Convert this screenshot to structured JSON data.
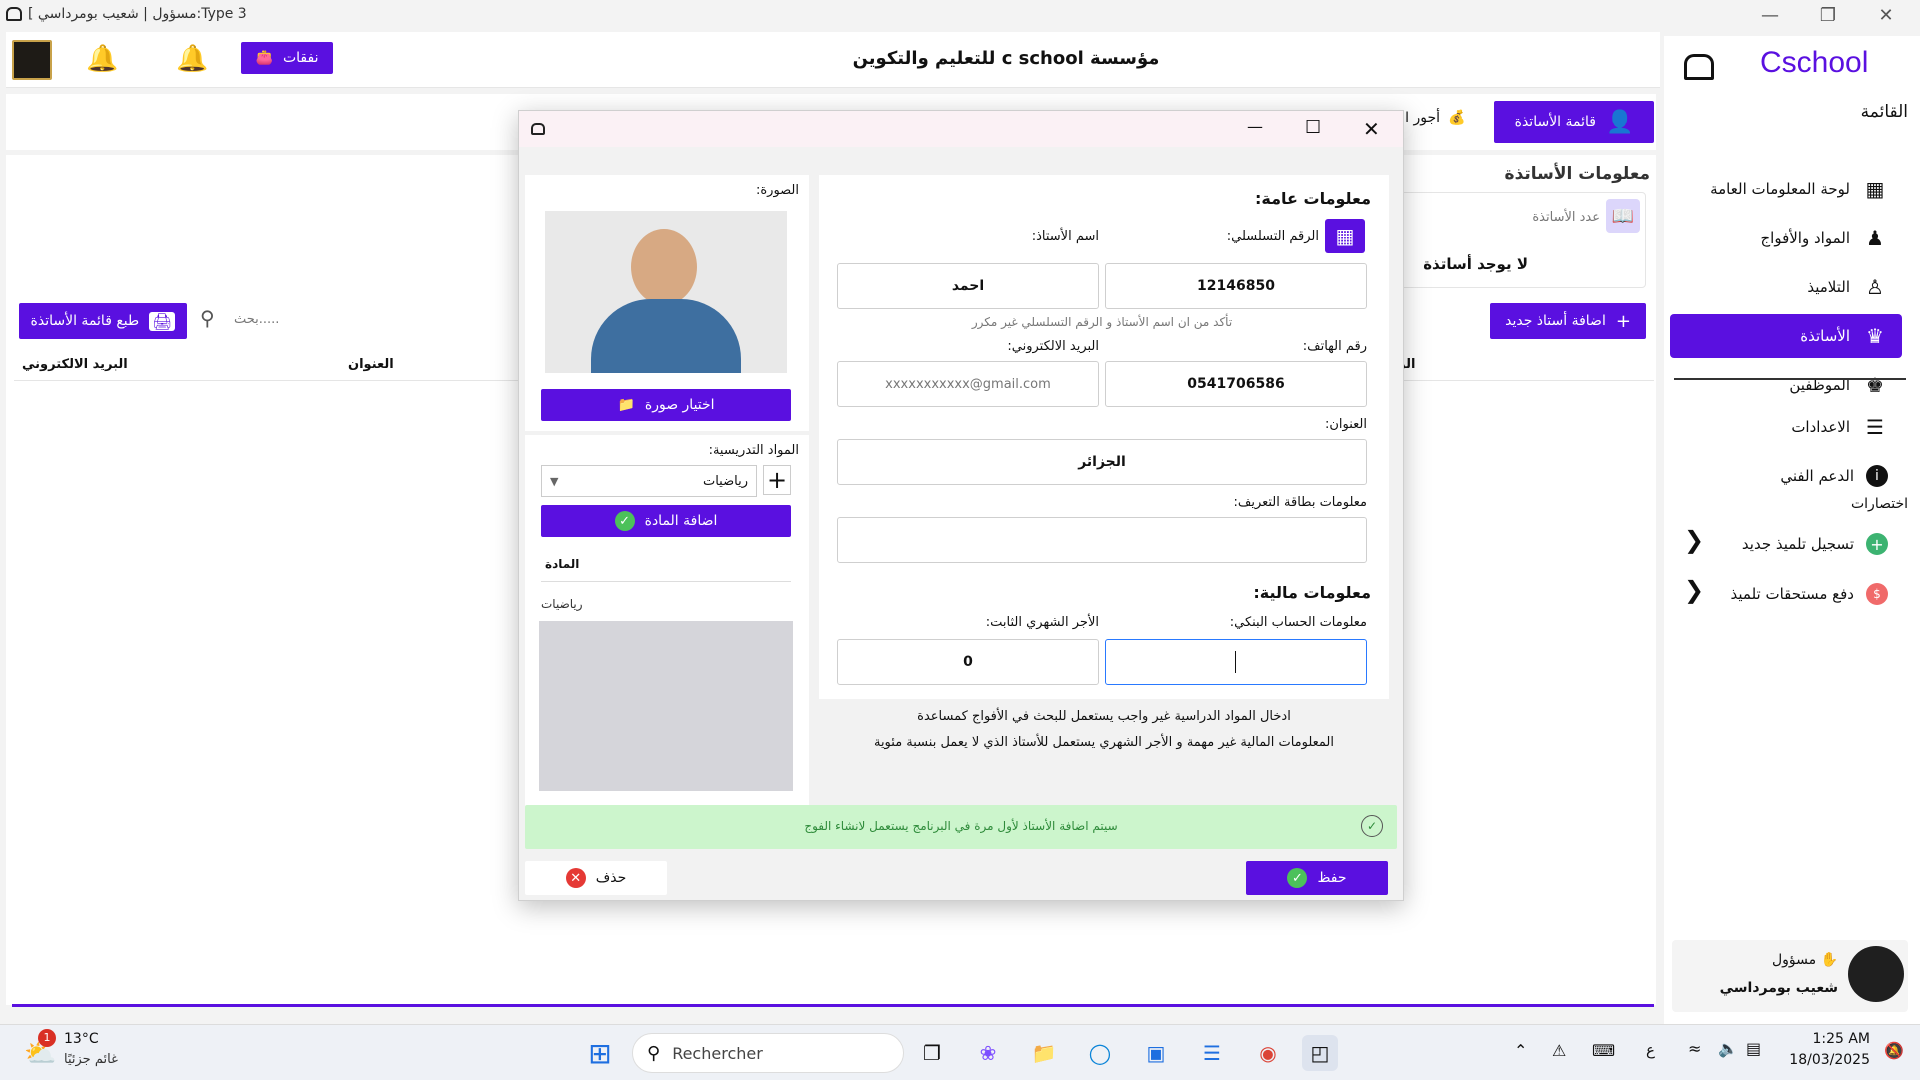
{
  "window": {
    "title": "[ مسؤول | شعيب بومرداسي:Type 3"
  },
  "header": {
    "title": "مؤسسة c school للتعليم والتكوين",
    "expenses_button": "نفقات"
  },
  "sidebar": {
    "brand": "Cschool",
    "menu_title": "القائمة",
    "items": [
      {
        "label": "لوحة المعلومات العامة",
        "icon": "dashboard-icon"
      },
      {
        "label": "المواد والأفواج",
        "icon": "groups-icon"
      },
      {
        "label": "التلاميذ",
        "icon": "students-icon"
      },
      {
        "label": "الأساتذة",
        "icon": "teacher-icon",
        "active": true
      },
      {
        "label": "الموظفين",
        "icon": "employees-icon"
      }
    ],
    "settings_items": [
      {
        "label": "الاعدادات",
        "icon": "sliders-icon"
      },
      {
        "label": "الدعم الفني",
        "icon": "info-icon"
      }
    ],
    "shortcuts_title": "اختصارات",
    "shortcuts": [
      {
        "label": "تسجيل تلميذ جديد",
        "icon": "plus-circle-icon"
      },
      {
        "label": "دفع مستحقات تلميذ",
        "icon": "cash-icon"
      }
    ],
    "user": {
      "role": "مسؤول",
      "name": "شعيب بومرداسي"
    }
  },
  "main": {
    "tab_teachers_list": "قائمة الأساتذة",
    "tab_salaries": "أجور ال",
    "section_title": "معلومات الأساتذة",
    "count_label": "عدد الأساتذة",
    "count_value": "لا يوجد أساتذة",
    "add_teacher_button": "اضافة أستاذ جديد",
    "print_button": "طبع قائمة الأساتذة",
    "search_placeholder": "بحث.....",
    "columns": {
      "email": "البريد الالكتروني",
      "address": "العنوان",
      "partial": "الر"
    }
  },
  "dialog": {
    "general_title": "معلومات عامة:",
    "serial_label": "الرقم التسلسلي:",
    "name_label": "اسم الأستاذ:",
    "serial_value": "12146850",
    "name_value": "احمد",
    "hint": "تأكد من ان اسم الأستاذ و الرقم التسلسلي غير مكرر",
    "phone_label": "رقم الهاتف:",
    "email_label": "البريد الالكتروني:",
    "phone_value": "0541706586",
    "email_placeholder": "xxxxxxxxxxx@gmail.com",
    "address_label": "العنوان:",
    "address_value": "الجزائر",
    "id_card_label": "معلومات بطاقة التعريف:",
    "id_card_value": "",
    "financial_title": "معلومات مالية:",
    "bank_label": "معلومات الحساب البنكي:",
    "salary_label": "الأجر الشهري الثابت:",
    "bank_value": "",
    "salary_value": "0",
    "note1": "ادخال المواد الدراسية غير واجب يستعمل للبحث في الأفواج كمساعدة",
    "note2": "المعلومات المالية غير مهمة و الأجر الشهري يستعمل للأستاذ الذي لا يعمل بنسبة مئوية",
    "photo_label": "الصورة:",
    "choose_photo_button": "اختيار صورة",
    "subjects_label": "المواد التدريسية:",
    "subject_select": "رياضيات",
    "add_subject_button": "اضافة المادة",
    "subject_column": "المادة",
    "subject_rows": [
      "رياضيات"
    ],
    "info_banner": "سيتم اضافة الأستاذ لأول مرة في البرنامج يستعمل لانشاء الفوج",
    "save_button": "حفظ",
    "delete_button": "حذف"
  },
  "taskbar": {
    "weather_temp": "13°C",
    "weather_desc": "غائم جزئيًا",
    "weather_badge": "1",
    "search_placeholder": "Rechercher",
    "time": "1:25 AM",
    "date": "18/03/2025",
    "lang": "ع"
  },
  "colors": {
    "accent": "#5a10e0",
    "success": "#4cc15a",
    "banner": "#ccf5cc",
    "danger": "#e53935"
  }
}
